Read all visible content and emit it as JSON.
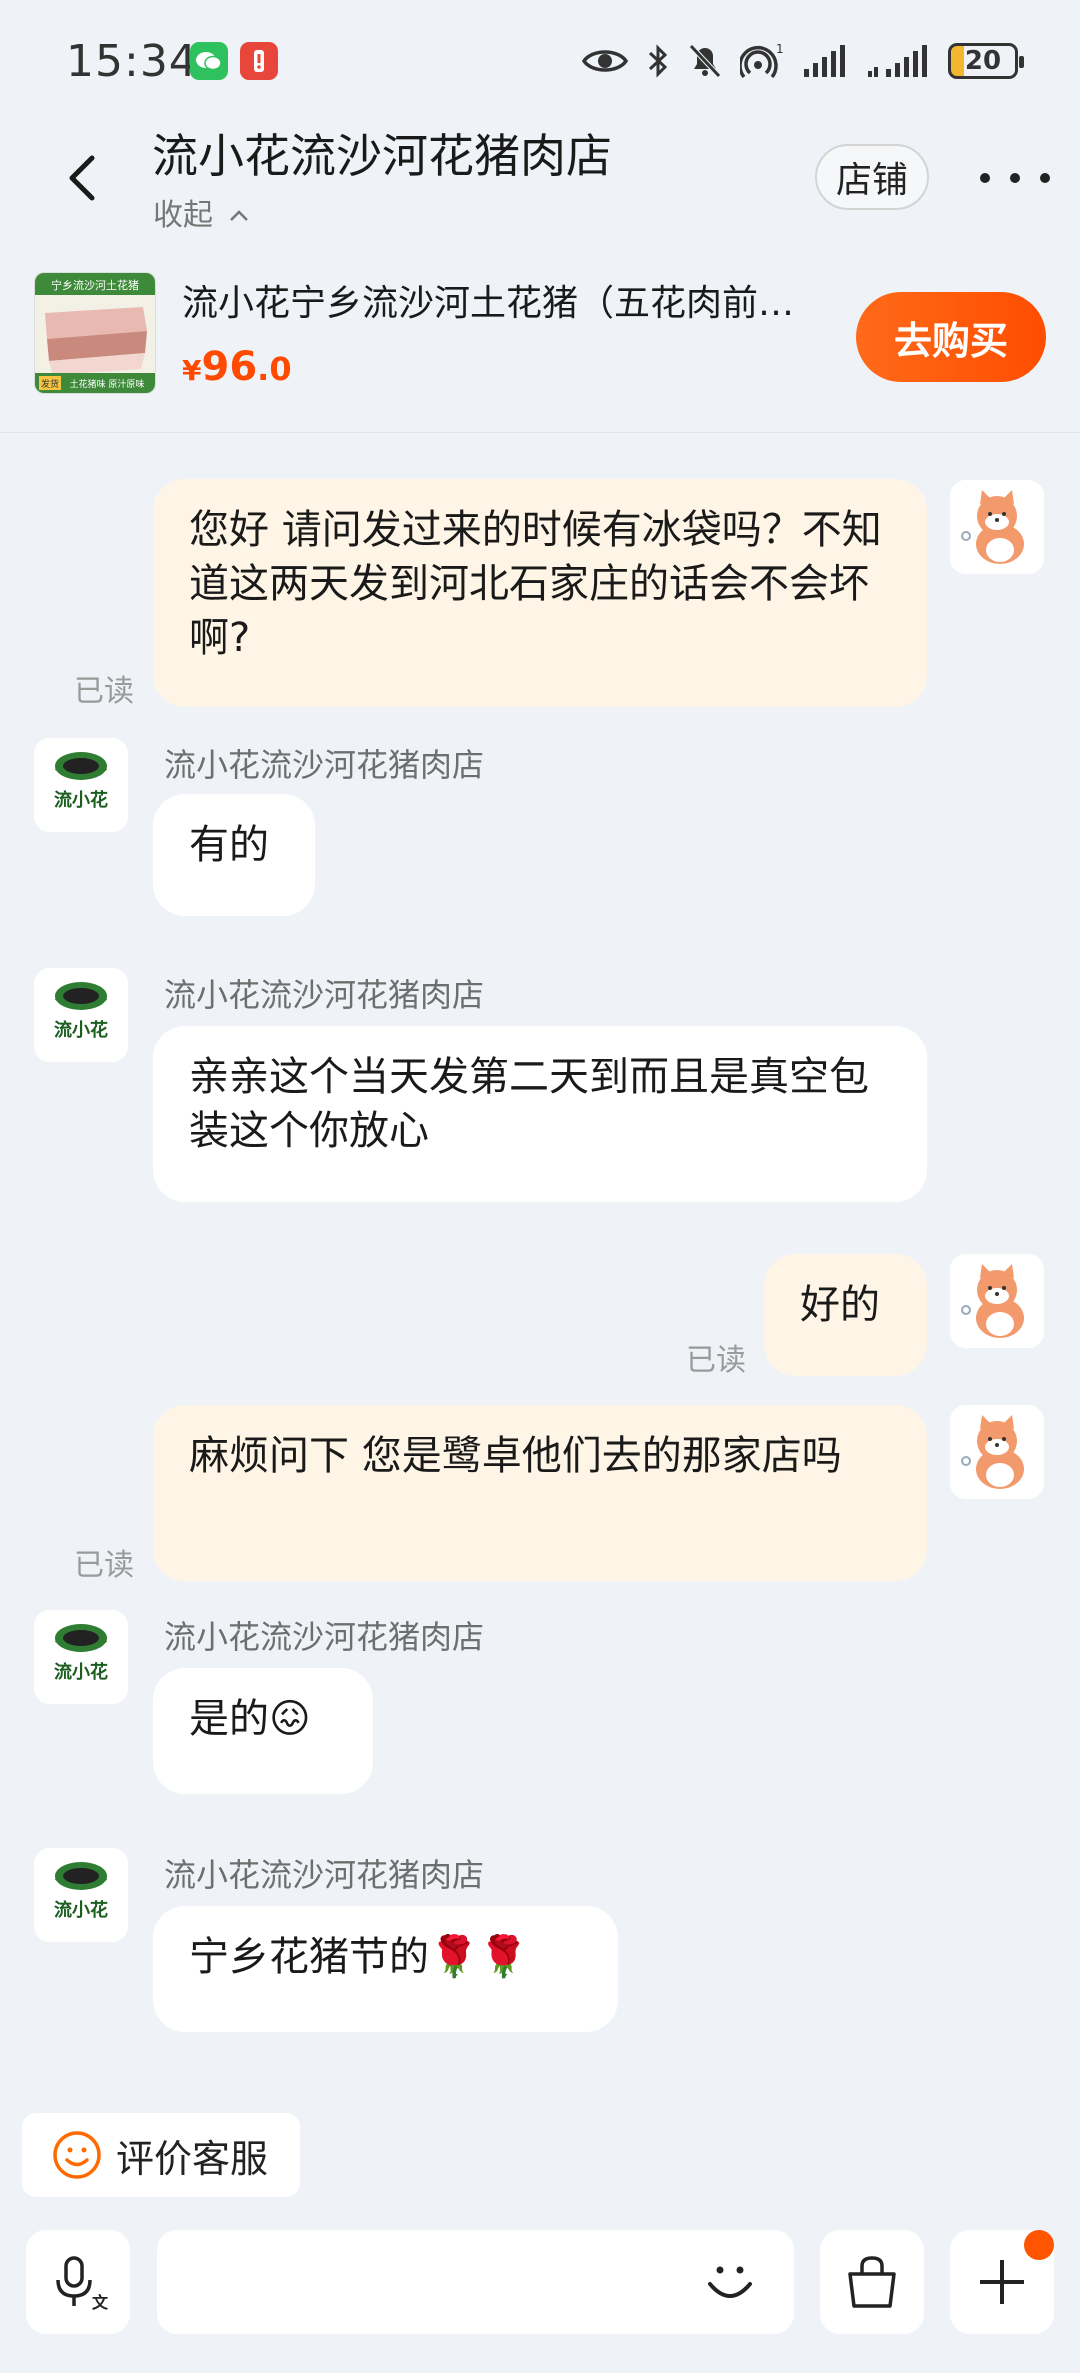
{
  "status_bar": {
    "time": "15:34",
    "battery": "20"
  },
  "header": {
    "title": "流小花流沙河花猪肉店",
    "collapse_label": "收起",
    "shop_button": "店铺"
  },
  "product": {
    "name": "流小花宁乡流沙河土花猪（五花肉前…",
    "price_symbol": "¥",
    "price_int": "96",
    "price_dec": ".0",
    "buy_button": "去购买",
    "thumb_banner": "宁乡流沙河土花猪",
    "thumb_tag": "发货",
    "thumb_caption": "土花猪味 原汁原味"
  },
  "chat": {
    "read_label": "已读",
    "shop_sender": "流小花流沙河花猪肉店",
    "shop_logo_text": "流小花",
    "messages": [
      {
        "from": "me",
        "text": "您好 请问发过来的时候有冰袋吗？不知道这两天发到河北石家庄的话会不会坏啊?"
      },
      {
        "from": "shop",
        "text": "有的"
      },
      {
        "from": "shop",
        "text": "亲亲这个当天发第二天到而且是真空包装这个你放心"
      },
      {
        "from": "me",
        "text": "好的"
      },
      {
        "from": "me",
        "text": "麻烦问下 您是鹭卓他们去的那家店吗"
      },
      {
        "from": "shop",
        "text": "是的",
        "emoji": "😖"
      },
      {
        "from": "shop",
        "text": "宁乡花猪节的",
        "emoji": "🌹🌹"
      }
    ]
  },
  "rate_button": "评价客服",
  "colors": {
    "accent": "#ff5500",
    "my_bubble": "#fff5e6",
    "background": "#eff3f8"
  }
}
